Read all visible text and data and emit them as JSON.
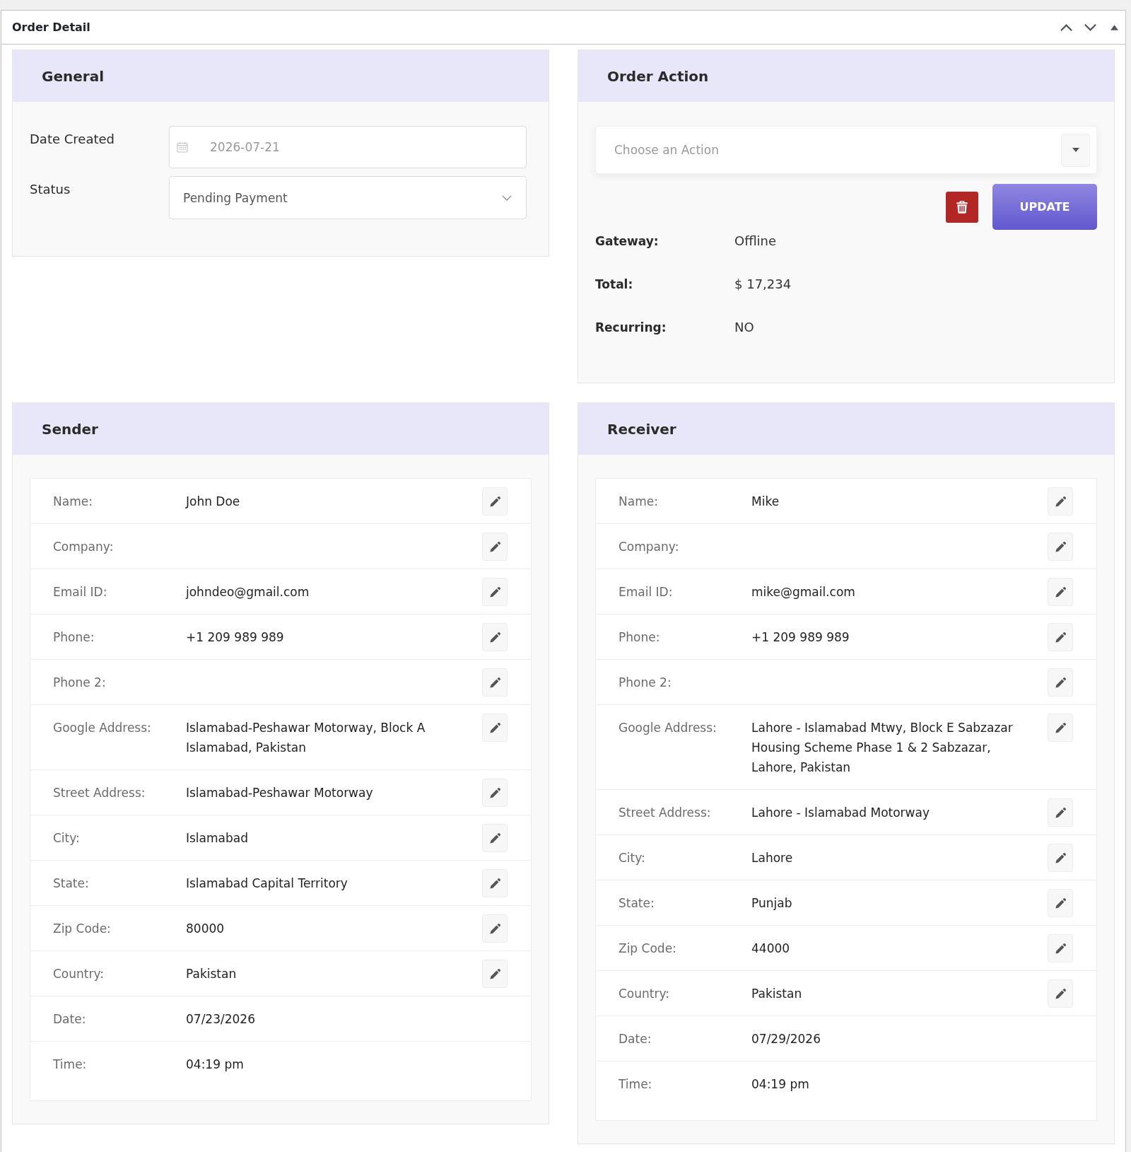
{
  "window": {
    "title": "Order Detail"
  },
  "general": {
    "title": "General",
    "fields": [
      {
        "kind": "date",
        "label": "Date Created",
        "value": "2026-07-21"
      },
      {
        "kind": "select",
        "label": "Status",
        "value": "Pending Payment"
      }
    ]
  },
  "order_action": {
    "title": "Order Action",
    "action_select": {
      "placeholder": "Choose an Action"
    },
    "update_button": "UPDATE",
    "details": [
      {
        "label": "Gateway:",
        "value": "Offline"
      },
      {
        "label": "Total:",
        "value": "$ 17,234"
      },
      {
        "label": "Recurring:",
        "value": "NO"
      }
    ]
  },
  "sender": {
    "title": "Sender",
    "rows": [
      {
        "label": "Name:",
        "value": "John Doe",
        "editable": true
      },
      {
        "label": "Company:",
        "editable": true
      },
      {
        "label": "Email ID:",
        "value": "johndeo@gmail.com",
        "editable": true
      },
      {
        "label": "Phone:",
        "value": "+1 209 989 989",
        "editable": true
      },
      {
        "label": "Phone 2:",
        "editable": true
      },
      {
        "label": "Google Address:",
        "value": "Islamabad-Peshawar Motorway, Block A Islamabad, Pakistan",
        "editable": true
      },
      {
        "label": "Street Address:",
        "value": "Islamabad-Peshawar Motorway",
        "editable": true
      },
      {
        "label": "City:",
        "value": "Islamabad",
        "editable": true
      },
      {
        "label": "State:",
        "value": "Islamabad Capital Territory",
        "editable": true
      },
      {
        "label": "Zip Code:",
        "value": "80000",
        "editable": true
      },
      {
        "label": "Country:",
        "value": "Pakistan",
        "editable": true
      },
      {
        "label": "Date:",
        "value": "07/23/2026",
        "editable": false
      },
      {
        "label": "Time:",
        "value": "04:19 pm",
        "editable": false
      }
    ]
  },
  "receiver": {
    "title": "Receiver",
    "rows": [
      {
        "label": "Name:",
        "value": "Mike",
        "editable": true
      },
      {
        "label": "Company:",
        "editable": true
      },
      {
        "label": "Email ID:",
        "value": "mike@gmail.com",
        "editable": true
      },
      {
        "label": "Phone:",
        "value": "+1 209 989 989",
        "editable": true
      },
      {
        "label": "Phone 2:",
        "editable": true
      },
      {
        "label": "Google Address:",
        "value": "Lahore - Islamabad Mtwy, Block E Sabzazar Housing Scheme Phase 1 & 2 Sabzazar, Lahore, Pakistan",
        "editable": true
      },
      {
        "label": "Street Address:",
        "value": "Lahore - Islamabad Motorway",
        "editable": true
      },
      {
        "label": "City:",
        "value": "Lahore",
        "editable": true
      },
      {
        "label": "State:",
        "value": "Punjab",
        "editable": true
      },
      {
        "label": "Zip Code:",
        "value": "44000",
        "editable": true
      },
      {
        "label": "Country:",
        "value": "Pakistan",
        "editable": true
      },
      {
        "label": "Date:",
        "value": "07/29/2026",
        "editable": false
      },
      {
        "label": "Time:",
        "value": "04:19 pm",
        "editable": false
      }
    ]
  }
}
